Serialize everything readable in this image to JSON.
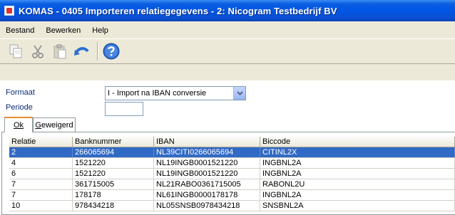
{
  "window": {
    "title": "KOMAS - 0405 Importeren relatiegegevens - 2: Nicogram Testbedrijf BV"
  },
  "menu": {
    "items": [
      "Bestand",
      "Bewerken",
      "Help"
    ]
  },
  "toolbar": {
    "icons": [
      "copy-icon",
      "cut-icon",
      "paste-icon",
      "undo-icon",
      "help-icon"
    ]
  },
  "form": {
    "format_label": "Formaat",
    "format_value": "I - Import na IBAN conversie",
    "period_label": "Periode",
    "period_value": ""
  },
  "tabs": {
    "ok_label": "Ok",
    "rejected_label": "Geweigerd"
  },
  "table": {
    "columns": [
      "Relatie",
      "Banknummer",
      "IBAN",
      "Biccode"
    ],
    "rows": [
      [
        "2",
        "266065694",
        "NL39CITI0266065694",
        "CITINL2X"
      ],
      [
        "4",
        "1521220",
        "NL19INGB0001521220",
        "INGBNL2A"
      ],
      [
        "6",
        "1521220",
        "NL19INGB0001521220",
        "INGBNL2A"
      ],
      [
        "7",
        "361715005",
        "NL21RABO0361715005",
        "RABONL2U"
      ],
      [
        "7",
        "178178",
        "NL61INGB0000178178",
        "INGBNL2A"
      ],
      [
        "10",
        "978434218",
        "NL05SNSB0978434218",
        "SNSBNL2A"
      ]
    ],
    "selected_row": 0
  },
  "colors": {
    "title_bar": "#0055e5",
    "selection": "#316ac5",
    "label_text": "#0a2a7a",
    "active_tab_accent": "#e68b2c"
  }
}
